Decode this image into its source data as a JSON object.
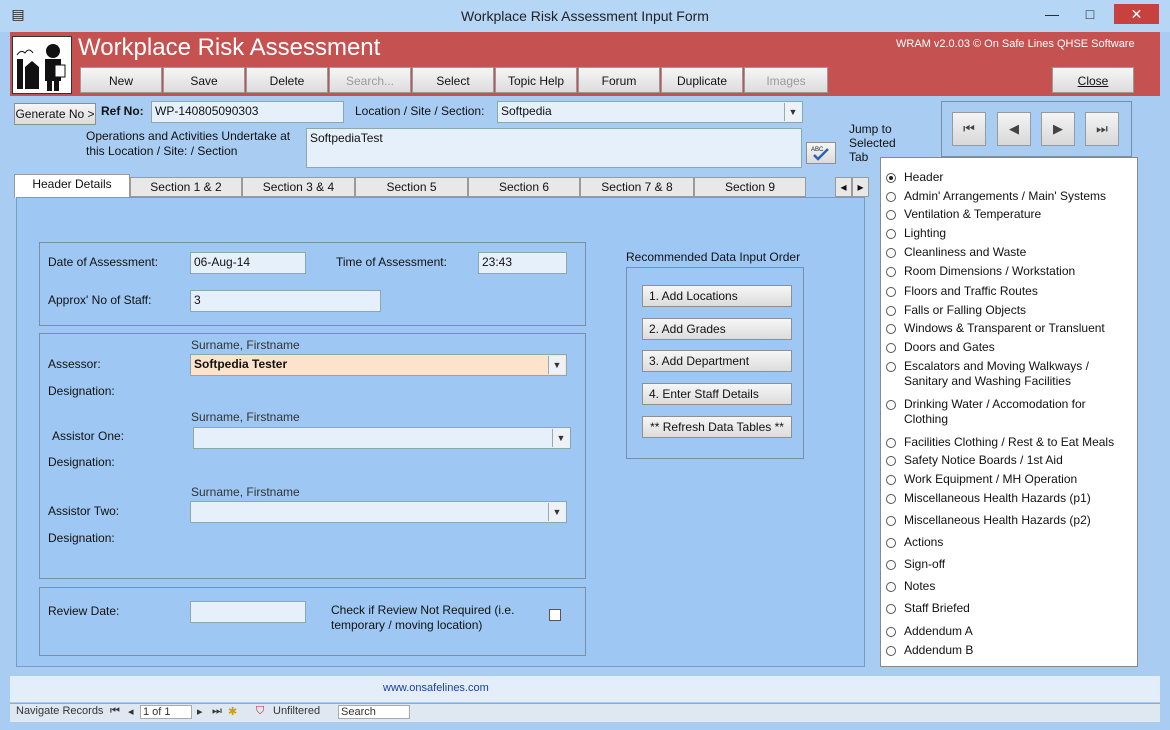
{
  "window": {
    "title": "Workplace Risk Assessment Input Form",
    "minimize": "—",
    "maximize": "□",
    "close": "✕"
  },
  "header": {
    "title": "Workplace Risk Assessment",
    "version": "WRAM v2.0.03 © On Safe Lines QHSE Software",
    "toolbar": [
      "New",
      "Save",
      "Delete",
      "Search...",
      "Select",
      "Topic Help",
      "Forum",
      "Duplicate",
      "Images"
    ],
    "close_label": "Close"
  },
  "form": {
    "generate_label": "Generate No >",
    "ref_label": "Ref No:",
    "ref_value": "WP-140805090303",
    "location_label": "Location / Site / Section:",
    "location_value": "Softpedia",
    "ops_label": "Operations and Activities Undertake at this Location / Site: / Section",
    "ops_value": "SoftpediaTest",
    "jump_label": "Jump to Selected Tab"
  },
  "tabs": [
    "Header Details",
    "Section 1 & 2",
    "Section 3 & 4",
    "Section 5",
    "Section 6",
    "Section 7 & 8",
    "Section 9"
  ],
  "header_details": {
    "date_label": "Date of Assessment:",
    "date_value": "06-Aug-14",
    "time_label": "Time of Assessment:",
    "time_value": "23:43",
    "staff_label": "Approx' No of Staff:",
    "staff_value": "3",
    "name_hint": "Surname, Firstname",
    "assessor_label": "Assessor:",
    "assessor_value": "Softpedia Tester",
    "designation_label": "Designation:",
    "assistor_one_label": "Assistor One:",
    "assistor_two_label": "Assistor Two:",
    "review_label": "Review Date:",
    "review_check_label": "Check if Review Not Required (i.e. temporary / moving location)"
  },
  "recommended": {
    "title": "Recommended Data Input Order",
    "buttons": [
      "1. Add Locations",
      "2. Add Grades",
      "3. Add Department",
      "4. Enter Staff Details",
      "** Refresh Data Tables **"
    ]
  },
  "tab_list": [
    "Header",
    "Admin' Arrangements / Main' Systems",
    "Ventilation & Temperature",
    "Lighting",
    "Cleanliness and Waste",
    "Room Dimensions / Workstation",
    "Floors and Traffic Routes",
    "Falls or Falling Objects",
    "Windows & Transparent or Transluent",
    "Doors and Gates",
    "Escalators and Moving Walkways / Sanitary and Washing Facilities",
    "Drinking Water / Accomodation for Clothing",
    "Facilities Clothing / Rest & to Eat Meals",
    "Safety Notice Boards / 1st Aid",
    "Work Equipment / MH Operation",
    "Miscellaneous Health Hazards (p1)",
    "Miscellaneous Health Hazards (p2)",
    "Actions",
    "Sign-off",
    "Notes",
    "Staff Briefed",
    "Addendum A",
    "Addendum B"
  ],
  "footer": {
    "url": "www.onsafelines.com",
    "navigate": "Navigate Records",
    "record": "1 of 1",
    "filter": "Unfiltered",
    "search": "Search"
  }
}
